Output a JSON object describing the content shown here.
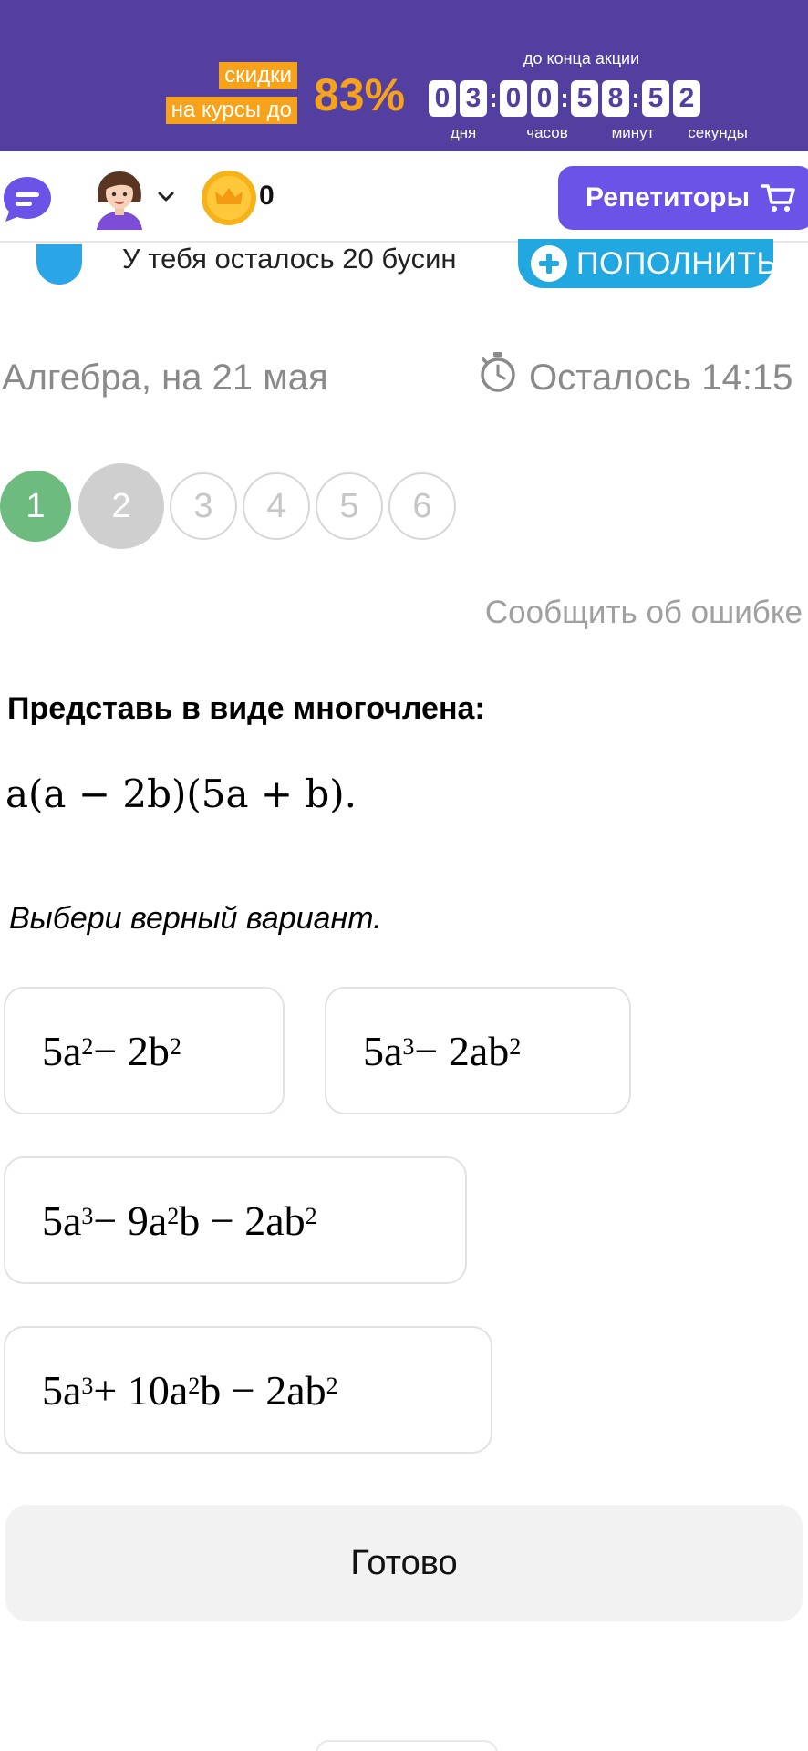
{
  "promo": {
    "label_line1": "скидки",
    "label_line2": "на курсы до",
    "percent": "83%",
    "until_label": "до конца акции",
    "timer": {
      "days": [
        "0",
        "3"
      ],
      "hours": [
        "0",
        "0"
      ],
      "minutes": [
        "5",
        "8"
      ],
      "seconds": [
        "5",
        "2"
      ],
      "separator": ":"
    },
    "units": {
      "days": "дня",
      "hours": "часов",
      "minutes": "минут",
      "seconds": "секунды"
    },
    "colors": {
      "background": "#533fa0",
      "accent": "#f7a21b"
    }
  },
  "nav": {
    "chat_icon": "chat-bubble-icon",
    "avatar_icon": "girl-avatar-icon",
    "coin_icon": "crown-coin-icon",
    "coin_count": "0",
    "tutors_label": "Репетиторы",
    "cart_icon": "cart-icon",
    "tutors_color": "#6a53e6"
  },
  "beads": {
    "text": "У тебя осталось 20 бусин",
    "topup_label": "ПОПОЛНИТЬ",
    "color": "#22a8e0"
  },
  "lesson": {
    "subject": "Алгебра, на 21 мая",
    "time_left": "Осталось 14:15",
    "steps": [
      {
        "label": "1",
        "state": "done"
      },
      {
        "label": "2",
        "state": "current"
      },
      {
        "label": "3",
        "state": "todo"
      },
      {
        "label": "4",
        "state": "todo"
      },
      {
        "label": "5",
        "state": "todo"
      },
      {
        "label": "6",
        "state": "todo"
      }
    ],
    "report_label": "Сообщить об ошибке"
  },
  "task": {
    "title": "Представь в виде многочлена:",
    "expression": "a(a − 2b)(5a + b).",
    "hint": "Выбери верный вариант."
  },
  "options": [
    {
      "parts": [
        "5a",
        "2",
        " − 2b",
        "2"
      ]
    },
    {
      "parts": [
        "5a",
        "3",
        " − 2ab",
        "2"
      ]
    },
    {
      "parts": [
        "5a",
        "3",
        " − 9a",
        "2",
        "b − 2ab",
        "2"
      ]
    },
    {
      "parts": [
        "5a",
        "3",
        " + 10a",
        "2",
        "b − 2ab",
        "2"
      ]
    }
  ],
  "done_label": "Готово"
}
